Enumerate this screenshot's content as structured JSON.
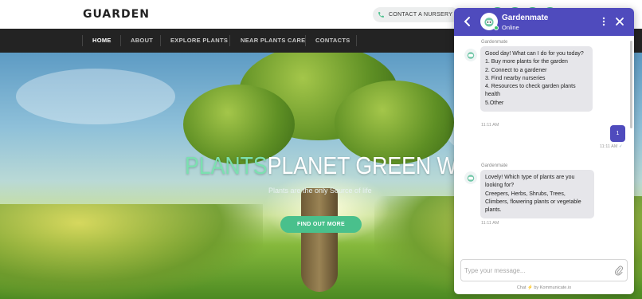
{
  "header": {
    "logo": "GUARDEN",
    "contact_button": "CONTACT A NURSERY",
    "social_icons": [
      "social-icon",
      "social-icon",
      "social-icon",
      "social-icon"
    ]
  },
  "nav": {
    "items": [
      {
        "label": "HOME",
        "active": true
      },
      {
        "label": "ABOUT",
        "active": false
      },
      {
        "label": "EXPLORE PLANTS",
        "active": false
      },
      {
        "label": "NEAR PLANTS CARE",
        "active": false
      },
      {
        "label": "CONTACTS",
        "active": false
      }
    ]
  },
  "hero": {
    "title_accent": "PLANTS",
    "title_rest": "PLANET GREEN WORLD",
    "subtitle": "Plants are the only Source of life",
    "cta": "FIND OUT MORE"
  },
  "chat": {
    "bot_name": "Gardenmate",
    "status": "Online",
    "messages": [
      {
        "sender": "Gardenmate",
        "lines": [
          "Good day! What can I do for you today?",
          "1. Buy more plants for the garden",
          "2. Connect to a gardener",
          "3. Find nearby nurseries",
          "4. Resources to check garden plants health",
          "5.Other"
        ],
        "time": "11:11 AM"
      },
      {
        "user_text": "1",
        "time": "11:11 AM"
      },
      {
        "sender": "Gardenmate",
        "lines": [
          "Lovely! Which type of plants are you looking for?",
          "Creepers, Herbs, Shrubs, Trees, Climbers, flowering plants or vegetable plants."
        ],
        "time": "11:11 AM"
      }
    ],
    "composer_placeholder": "Type your message...",
    "powered_prefix": "Chat",
    "powered_suffix": "by Kommunicate.io"
  },
  "colors": {
    "brand_green": "#49c08c",
    "chat_purple": "#4f4bbd",
    "nav_bg": "#232323"
  }
}
